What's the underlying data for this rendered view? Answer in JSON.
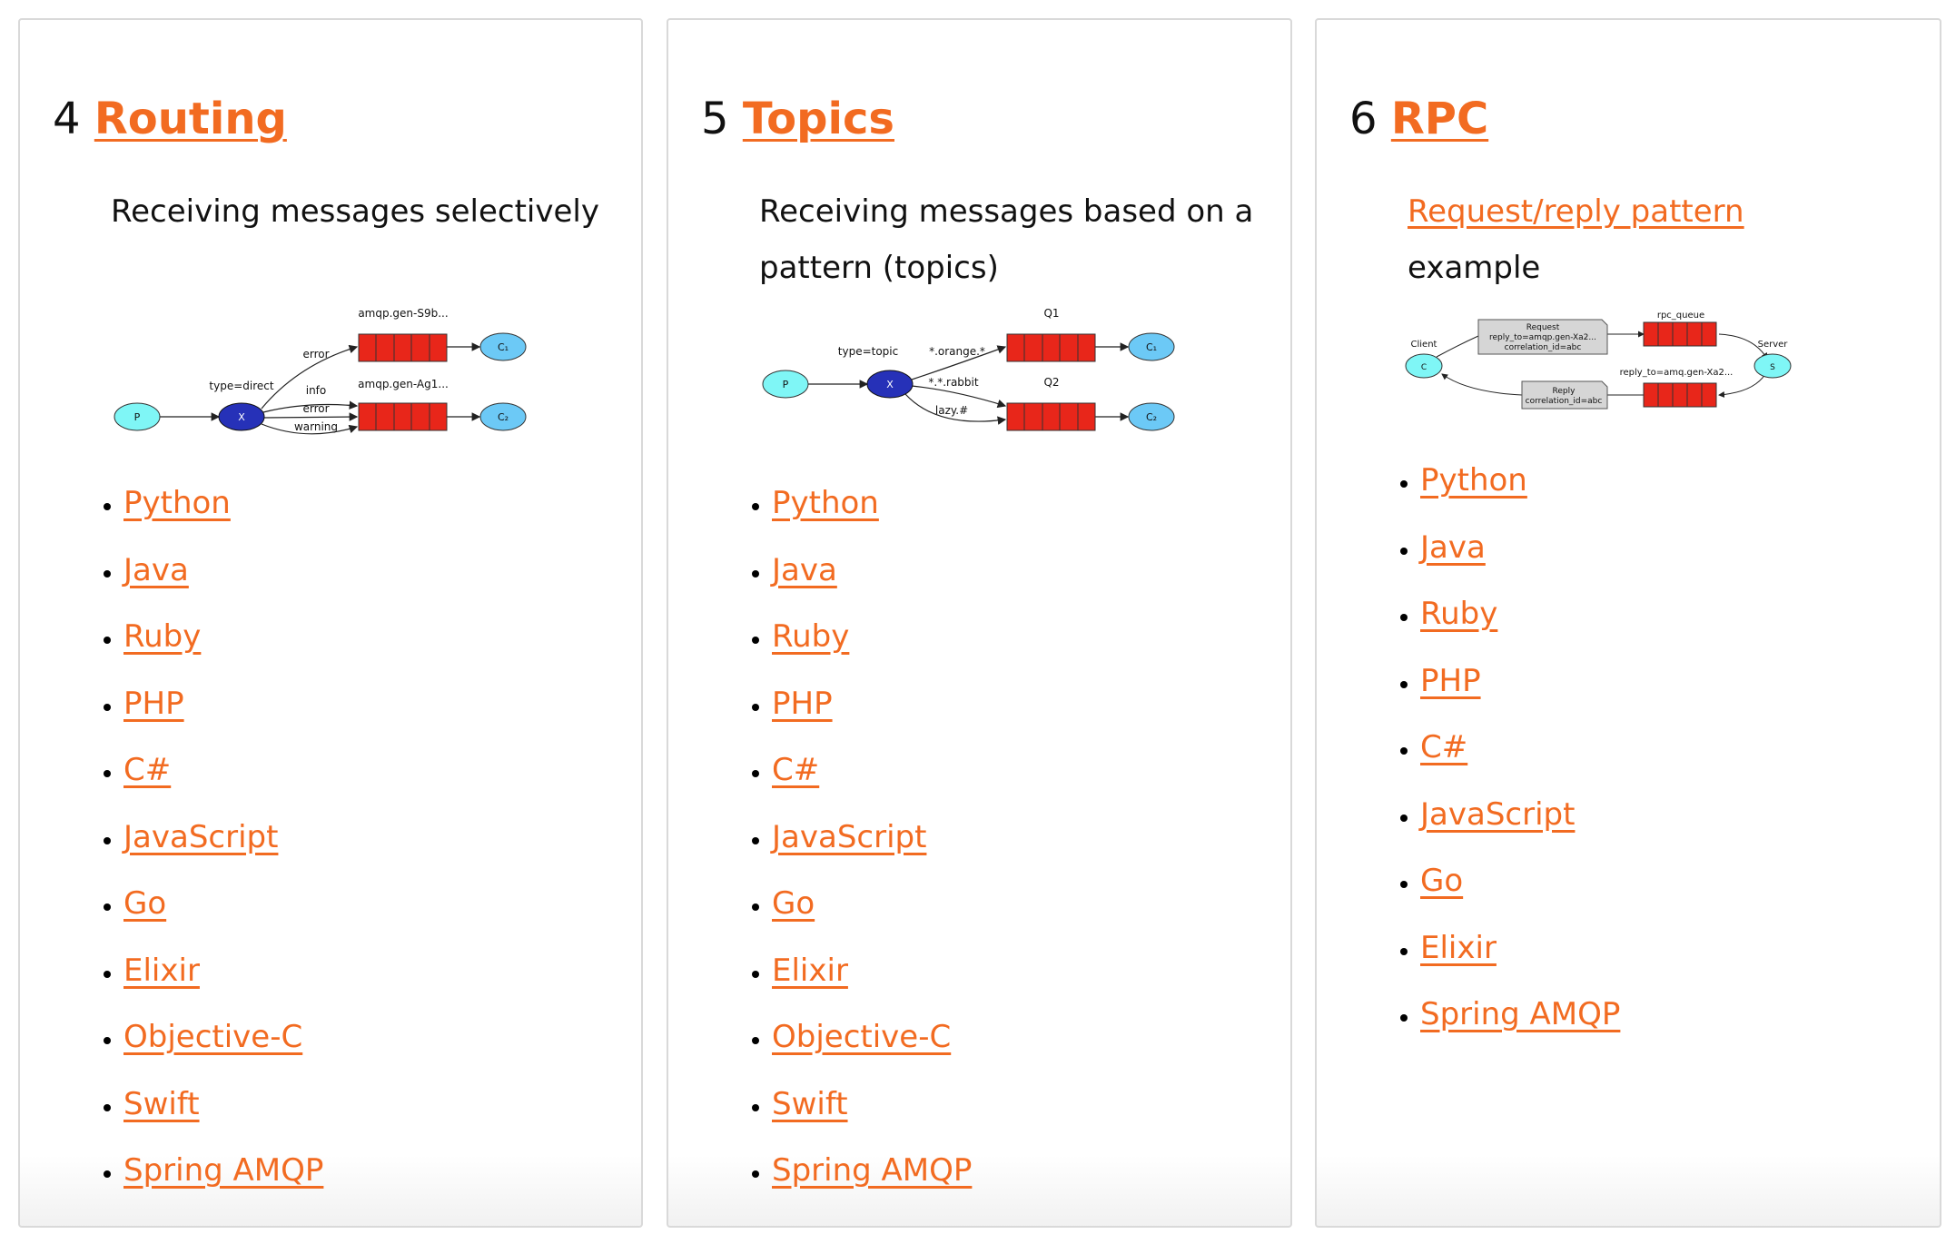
{
  "cards": [
    {
      "number": "4",
      "title": "Routing",
      "description": "Receiving messages selectively",
      "diagram": {
        "producer": "P",
        "exchange": "X",
        "exchange_label": "type=direct",
        "queue1": "amqp.gen-S9b...",
        "queue2": "amqp.gen-Ag1...",
        "edge_q1": "error",
        "edge_q2a": "info",
        "edge_q2b": "error",
        "edge_q2c": "warning",
        "consumer1": "C₁",
        "consumer2": "C₂"
      },
      "languages": [
        "Python",
        "Java",
        "Ruby",
        "PHP",
        "C#",
        "JavaScript",
        "Go",
        "Elixir",
        "Objective-C",
        "Swift",
        "Spring AMQP"
      ]
    },
    {
      "number": "5",
      "title": "Topics",
      "description": "Receiving messages based on a pattern (topics)",
      "diagram": {
        "producer": "P",
        "exchange": "X",
        "exchange_label": "type=topic",
        "queue1": "Q1",
        "queue2": "Q2",
        "edge_q1": "*.orange.*",
        "edge_q2a": "*.*.rabbit",
        "edge_q2b": "lazy.#",
        "consumer1": "C₁",
        "consumer2": "C₂"
      },
      "languages": [
        "Python",
        "Java",
        "Ruby",
        "PHP",
        "C#",
        "JavaScript",
        "Go",
        "Elixir",
        "Objective-C",
        "Swift",
        "Spring AMQP"
      ]
    },
    {
      "number": "6",
      "title": "RPC",
      "description_link": "Request/reply pattern",
      "description_suffix": "example",
      "diagram": {
        "client_label": "Client",
        "client": "C",
        "server_label": "Server",
        "server": "S",
        "request_line1": "Request",
        "request_line2": "reply_to=amqp.gen-Xa2...",
        "request_line3": "correlation_id=abc",
        "reply_line1": "Reply",
        "reply_line2": "correlation_id=abc",
        "rpc_queue": "rpc_queue",
        "reply_queue": "reply_to=amq.gen-Xa2..."
      },
      "languages": [
        "Python",
        "Java",
        "Ruby",
        "PHP",
        "C#",
        "JavaScript",
        "Go",
        "Elixir",
        "Spring AMQP"
      ]
    }
  ],
  "colors": {
    "accent": "#f26b21",
    "producer_fill": "#7ff6f6",
    "exchange_fill": "#2631b8",
    "queue_fill": "#e8261a",
    "consumer_fill": "#6cc9f6"
  }
}
